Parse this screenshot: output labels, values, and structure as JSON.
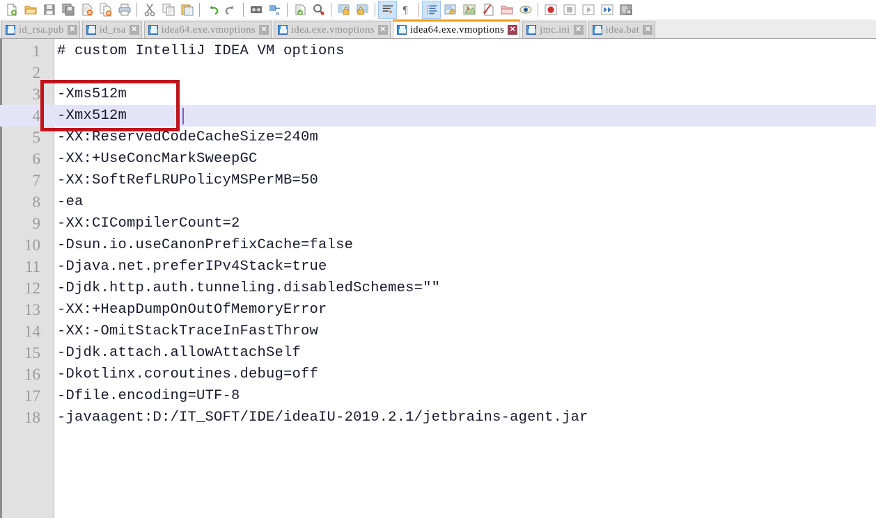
{
  "window": {
    "app_kind": "text-editor",
    "accent_active_tab": "#f39c12",
    "annotation_box_color": "#c0131a",
    "current_line_highlight": "#e4e4f8",
    "gutter_color": "#e1e1e1"
  },
  "toolbar": {
    "groups": [
      [
        {
          "name": "new-file-icon",
          "label": "New"
        },
        {
          "name": "open-folder-icon",
          "label": "Open"
        },
        {
          "name": "save-icon",
          "label": "Save"
        },
        {
          "name": "save-all-icon",
          "label": "Save All"
        },
        {
          "name": "close-file-icon",
          "label": "Close"
        },
        {
          "name": "close-all-files-icon",
          "label": "Close All"
        },
        {
          "name": "print-icon",
          "label": "Print"
        }
      ],
      [
        {
          "name": "cut-icon",
          "label": "Cut"
        },
        {
          "name": "copy-icon",
          "label": "Copy"
        },
        {
          "name": "paste-icon",
          "label": "Paste"
        }
      ],
      [
        {
          "name": "undo-icon",
          "label": "Undo"
        },
        {
          "name": "redo-icon",
          "label": "Redo"
        }
      ],
      [
        {
          "name": "find-icon",
          "label": "Find"
        },
        {
          "name": "replace-icon",
          "label": "Replace"
        }
      ],
      [
        {
          "name": "go-to-line-icon",
          "label": "Go To Line"
        },
        {
          "name": "find-in-files-icon",
          "label": "Find in Files"
        }
      ],
      [
        {
          "name": "lock-left-icon",
          "label": "Lock Left"
        },
        {
          "name": "lock-right-icon",
          "label": "Lock Right"
        }
      ],
      [
        {
          "name": "word-wrap-icon",
          "label": "Word Wrap",
          "active": true
        },
        {
          "name": "show-all-characters-icon",
          "label": "Show All Characters"
        }
      ],
      [
        {
          "name": "indent-guide-icon",
          "label": "Indent Guide",
          "active": true
        },
        {
          "name": "user-defined-language-icon",
          "label": "User-Defined Language"
        },
        {
          "name": "document-map-icon",
          "label": "Document Map"
        },
        {
          "name": "function-list-icon",
          "label": "Function List"
        },
        {
          "name": "folder-as-workspace-icon",
          "label": "Folder as Workspace"
        },
        {
          "name": "monitoring-icon",
          "label": "Document Monitoring"
        }
      ],
      [
        {
          "name": "record-macro-icon",
          "label": "Start Recording"
        },
        {
          "name": "stop-macro-icon",
          "label": "Stop Recording"
        },
        {
          "name": "play-macro-icon",
          "label": "Playback"
        },
        {
          "name": "run-macro-multiple-icon",
          "label": "Run a Macro Multiple Times"
        },
        {
          "name": "save-macro-icon",
          "label": "Save Current Recorded Macro"
        }
      ]
    ]
  },
  "tabs": [
    {
      "label": "id_rsa.pub",
      "active": false,
      "close_label": "✕"
    },
    {
      "label": "id_rsa",
      "active": false,
      "close_label": "✕"
    },
    {
      "label": "idea64.exe.vmoptions",
      "active": false,
      "close_label": "✕"
    },
    {
      "label": "idea.exe.vmoptions",
      "active": false,
      "close_label": "✕"
    },
    {
      "label": "idea64.exe.vmoptions",
      "active": true,
      "close_label": "✕"
    },
    {
      "label": "jmc.ini",
      "active": false,
      "close_label": "✕"
    },
    {
      "label": "idea.bat",
      "active": false,
      "close_label": "✕"
    }
  ],
  "editor": {
    "current_line": 4,
    "caret_line": 4,
    "caret_column": 10,
    "lines": [
      {
        "number": "1",
        "text": "# custom IntelliJ IDEA VM options"
      },
      {
        "number": "2",
        "text": ""
      },
      {
        "number": "3",
        "text": "-Xms512m"
      },
      {
        "number": "4",
        "text": "-Xmx512m"
      },
      {
        "number": "5",
        "text": "-XX:ReservedCodeCacheSize=240m"
      },
      {
        "number": "6",
        "text": "-XX:+UseConcMarkSweepGC"
      },
      {
        "number": "7",
        "text": "-XX:SoftRefLRUPolicyMSPerMB=50"
      },
      {
        "number": "8",
        "text": "-ea"
      },
      {
        "number": "9",
        "text": "-XX:CICompilerCount=2"
      },
      {
        "number": "10",
        "text": "-Dsun.io.useCanonPrefixCache=false"
      },
      {
        "number": "11",
        "text": "-Djava.net.preferIPv4Stack=true"
      },
      {
        "number": "12",
        "text": "-Djdk.http.auth.tunneling.disabledSchemes=\"\""
      },
      {
        "number": "13",
        "text": "-XX:+HeapDumpOnOutOfMemoryError"
      },
      {
        "number": "14",
        "text": "-XX:-OmitStackTraceInFastThrow"
      },
      {
        "number": "15",
        "text": "-Djdk.attach.allowAttachSelf"
      },
      {
        "number": "16",
        "text": "-Dkotlinx.coroutines.debug=off"
      },
      {
        "number": "17",
        "text": "-Dfile.encoding=UTF-8"
      },
      {
        "number": "18",
        "text": "-javaagent:D:/IT_SOFT/IDE/ideaIU-2019.2.1/jetbrains-agent.jar"
      }
    ],
    "annotation": {
      "kind": "rectangle-highlight",
      "covers_lines": [
        "3",
        "4"
      ],
      "color": "#c0131a"
    }
  }
}
